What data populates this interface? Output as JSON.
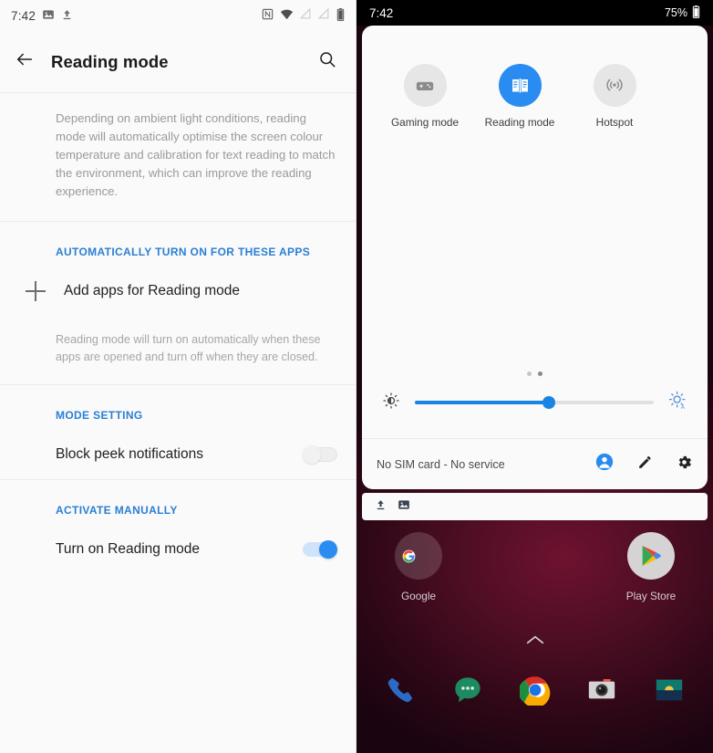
{
  "left": {
    "status_bar": {
      "time": "7:42",
      "icons_left": [
        "screenshot-icon",
        "upload-icon"
      ],
      "icons_right": [
        "nfc-icon",
        "wifi-icon",
        "signal-empty-icon",
        "signal-empty-icon",
        "battery-icon"
      ]
    },
    "appbar": {
      "back_icon": "back-arrow-icon",
      "title": "Reading mode",
      "search_icon": "search-icon"
    },
    "description": "Depending on ambient light conditions, reading mode will automatically optimise the screen colour temperature and calibration for text reading to match the environment, which can improve the reading experience.",
    "section_apps": {
      "header": "AUTOMATICALLY TURN ON FOR THESE APPS",
      "add_label": "Add apps for Reading mode",
      "note": "Reading mode will turn on automatically when these apps are opened and turn off when they are closed."
    },
    "section_mode": {
      "header": "MODE SETTING",
      "block_peek_label": "Block peek notifications",
      "block_peek_state": "off"
    },
    "section_manual": {
      "header": "ACTIVATE MANUALLY",
      "turn_on_label": "Turn on Reading mode",
      "turn_on_state": "on"
    },
    "accent_blue": "#2a7fd4",
    "toggle_on_color": "#2a8cf0"
  },
  "right": {
    "status_bar": {
      "time": "7:42",
      "battery_percent": "75%",
      "battery_icon": "battery-icon"
    },
    "quick_settings": {
      "tiles": [
        {
          "label": "Gaming mode",
          "icon": "gamepad-icon",
          "active": false
        },
        {
          "label": "Reading mode",
          "icon": "open-book-icon",
          "active": true
        },
        {
          "label": "Hotspot",
          "icon": "hotspot-icon",
          "active": false
        }
      ],
      "page_dots": {
        "count": 2,
        "active_index": 1
      },
      "brightness": {
        "low_icon": "brightness-low-icon",
        "auto_icon": "brightness-auto-icon",
        "value_percent": 56
      },
      "footer": {
        "carrier_text": "No SIM card - No service",
        "user_icon": "user-avatar-icon",
        "edit_icon": "pencil-icon",
        "settings_icon": "gear-icon"
      }
    },
    "notification_strip": {
      "icons": [
        "upload-icon",
        "screenshot-icon"
      ]
    },
    "home_screen": {
      "apps": [
        {
          "name": "Google",
          "icon": "google-folder-icon"
        },
        {
          "name": "Play Store",
          "icon": "play-store-icon"
        }
      ],
      "app_drawer_icon": "chevron-up-icon",
      "dock": [
        {
          "icon": "phone-icon"
        },
        {
          "icon": "messages-icon"
        },
        {
          "icon": "chrome-icon"
        },
        {
          "icon": "camera-icon"
        },
        {
          "icon": "gallery-icon"
        }
      ]
    },
    "active_tile_color": "#2a8cf0"
  }
}
